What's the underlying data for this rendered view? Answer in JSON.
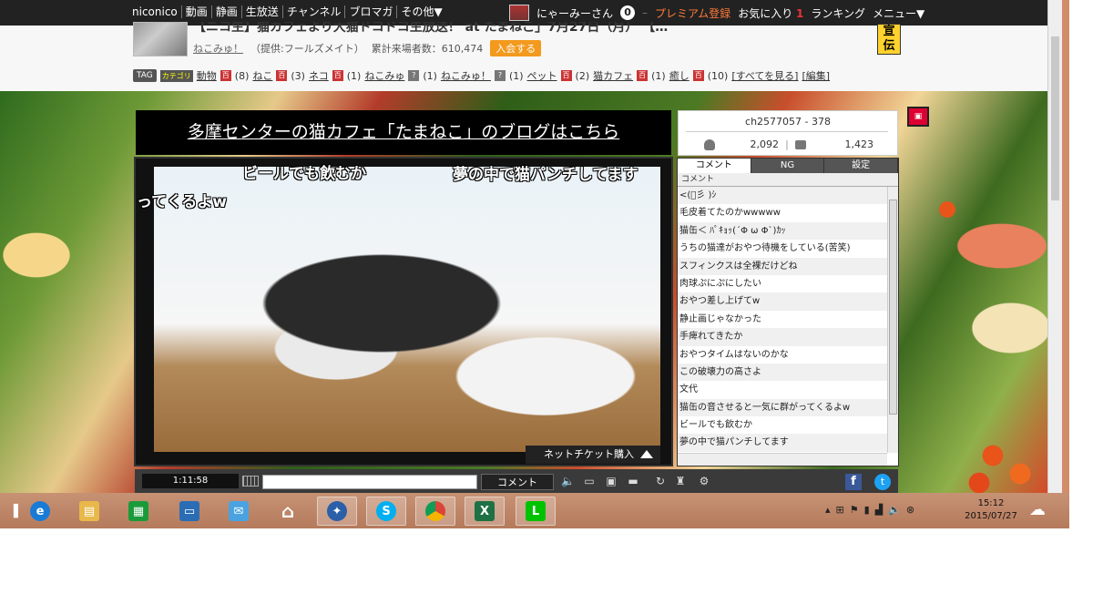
{
  "topnav": {
    "items": [
      "niconico",
      "動画",
      "静画",
      "生放送",
      "チャンネル",
      "ブロマガ",
      "その他▼"
    ],
    "username": "にゃーみーさん",
    "badge": "0",
    "premium": "プレミアム登録",
    "favorites": "お気に入り",
    "favorites_count": "1",
    "ranking": "ランキング",
    "menu": "メニュー▼"
  },
  "channel": {
    "title": "【ニコ生】猫カフェより大猫ドコドコ生放送！ at たまねこ」7月27日（月） 【…",
    "name": "ねこみゅ！",
    "provider": "（提供:フールズメイト）",
    "visitors_label": "累計来場者数：610,474",
    "join": "入会する",
    "ad_text": "宣伝"
  },
  "tags": {
    "tag_label": "TAG",
    "category_label": "カテゴリ",
    "items": [
      {
        "name": "動物",
        "count": "(8)"
      },
      {
        "name": "ねこ",
        "count": "(3)"
      },
      {
        "name": "ネコ",
        "count": "(1)"
      },
      {
        "name": "ねこみゅ",
        "count": "(1)"
      },
      {
        "name": "ねこみゅ！",
        "count": "(1)"
      },
      {
        "name": "ペット",
        "count": "(2)"
      },
      {
        "name": "猫カフェ",
        "count": "(1)"
      },
      {
        "name": "癒し",
        "count": "(10)"
      }
    ],
    "see_all": "[すべてを見る]",
    "edit": "[編集]"
  },
  "player": {
    "banner": "多摩センターの猫カフェ「たまねこ」のブログはこちら",
    "ticket": "ネットチケット購入",
    "danmaku": [
      "ビールでも飲むか",
      "夢の中で猫パンチしてます",
      "ってくるよw"
    ],
    "time": "1:11:58",
    "comment_button": "コメント"
  },
  "stats": {
    "channel_id": "ch2577057 - 378",
    "viewers": "2,092",
    "comments": "1,423"
  },
  "comment_panel": {
    "tabs": [
      "コメント",
      "NG",
      "設定"
    ],
    "header": "コメント",
    "comments": [
      "<(ﾟ彡 )ｼ",
      "毛皮着てたのかwwwww",
      "猫缶＜ ﾊﾟｷｮｯ(´Φ ω Φ`)ｶｯ",
      "うちの猫達がおやつ待機をしている(苦笑)",
      "スフィンクスは全裸だけどね",
      "肉球ぷにぷにしたい",
      "おやつ差し上げてw",
      "静止画じゃなかった",
      "手痺れてきたか",
      "おやつタイムはないのかな",
      "この破壊力の高さよ",
      "文代",
      "猫缶の音させると一気に群がってくるよw",
      "ビールでも飲むか",
      "夢の中で猫パンチしてます"
    ]
  },
  "taskbar": {
    "time": "15:12",
    "date": "2015/07/27"
  }
}
